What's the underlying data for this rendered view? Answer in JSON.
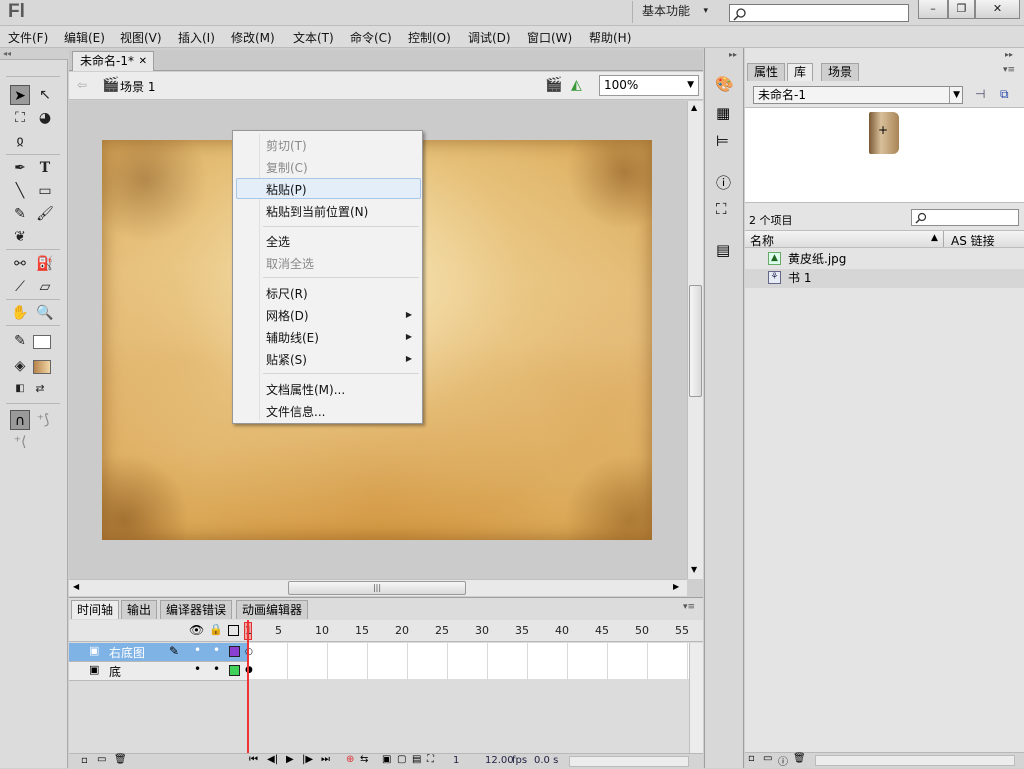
{
  "app": {
    "logo": "Fl",
    "workspace": "基本功能",
    "search_placeholder": "",
    "window_buttons": [
      "–",
      "❐",
      "✕"
    ]
  },
  "menubar": [
    "文件(F)",
    "编辑(E)",
    "视图(V)",
    "插入(I)",
    "修改(M)",
    "文本(T)",
    "命令(C)",
    "控制(O)",
    "调试(D)",
    "窗口(W)",
    "帮助(H)"
  ],
  "document": {
    "tab_title": "未命名-1*",
    "scene": "场景 1",
    "zoom": "100%"
  },
  "context_menu": {
    "items": [
      {
        "label": "剪切(T)",
        "enabled": false
      },
      {
        "label": "复制(C)",
        "enabled": false
      },
      {
        "label": "粘贴(P)",
        "enabled": true,
        "highlighted": true
      },
      {
        "label": "粘贴到当前位置(N)",
        "enabled": true
      },
      {
        "label": "全选",
        "enabled": true
      },
      {
        "label": "取消全选",
        "enabled": false
      },
      {
        "label": "标尺(R)",
        "enabled": true
      },
      {
        "label": "网格(D)",
        "enabled": true,
        "submenu": true
      },
      {
        "label": "辅助线(E)",
        "enabled": true,
        "submenu": true
      },
      {
        "label": "贴紧(S)",
        "enabled": true,
        "submenu": true
      },
      {
        "label": "文档属性(M)...",
        "enabled": true
      },
      {
        "label": "文件信息...",
        "enabled": true
      }
    ]
  },
  "timeline": {
    "tabs": [
      "时间轴",
      "输出",
      "编译器错误",
      "动画编辑器"
    ],
    "frame_numbers": [
      "1",
      "5",
      "10",
      "15",
      "20",
      "25",
      "30",
      "35",
      "40",
      "45",
      "50",
      "55"
    ],
    "layers": [
      {
        "name": "右底图",
        "color": "#8a3fd1",
        "selected": true
      },
      {
        "name": "底",
        "color": "#3fd15a",
        "selected": false
      }
    ],
    "current_frame": "1",
    "fps": "12.00",
    "fps_unit": "fps",
    "elapsed": "0.0 s"
  },
  "library": {
    "tabs": [
      "属性",
      "库",
      "场景"
    ],
    "document_select": "未命名-1",
    "item_count": "2 个项目",
    "col_name": "名称",
    "col_linkage": "AS 链接",
    "items": [
      {
        "name": "黄皮纸.jpg",
        "icon": "bitmap-icon"
      },
      {
        "name": "书 1",
        "icon": "movieclip-icon"
      }
    ]
  },
  "colors": {
    "accent_selection": "#7fb2e5",
    "playhead": "#e33333"
  }
}
